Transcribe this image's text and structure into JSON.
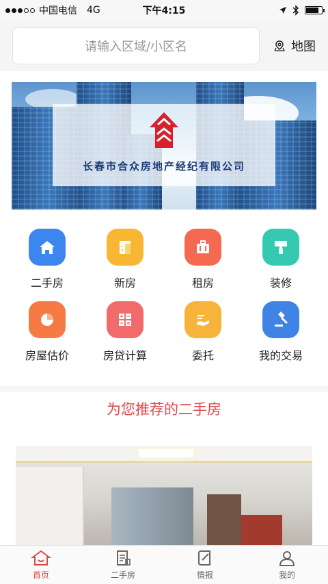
{
  "status_bar": {
    "carrier": "中国电信",
    "network": "4G",
    "time": "下午4:15"
  },
  "header": {
    "search_placeholder": "请输入区域/小区名",
    "map_label": "地图"
  },
  "banner": {
    "company_name": "长春市合众房地产经纪有限公司"
  },
  "grid": [
    {
      "label": "二手房",
      "icon": "house-icon",
      "color": "#3d86f0"
    },
    {
      "label": "新房",
      "icon": "building-icon",
      "color": "#f7b733"
    },
    {
      "label": "租房",
      "icon": "suitcase-icon",
      "color": "#f4694f"
    },
    {
      "label": "装修",
      "icon": "paint-roller-icon",
      "color": "#35c9b1"
    },
    {
      "label": "房屋估价",
      "icon": "pie-chart-icon",
      "color": "#f57a44"
    },
    {
      "label": "房贷计算",
      "icon": "calculator-icon",
      "color": "#f26b6b"
    },
    {
      "label": "委托",
      "icon": "handshake-icon",
      "color": "#f8b43a"
    },
    {
      "label": "我的交易",
      "icon": "gavel-icon",
      "color": "#3f83e4"
    }
  ],
  "recommend": {
    "title": "为您推荐的二手房"
  },
  "tabbar": [
    {
      "label": "首页",
      "icon": "home-icon",
      "active": true
    },
    {
      "label": "二手房",
      "icon": "document-icon",
      "active": false
    },
    {
      "label": "情报",
      "icon": "notebook-icon",
      "active": false
    },
    {
      "label": "我的",
      "icon": "user-icon",
      "active": false
    }
  ],
  "colors": {
    "accent": "#e04848"
  }
}
